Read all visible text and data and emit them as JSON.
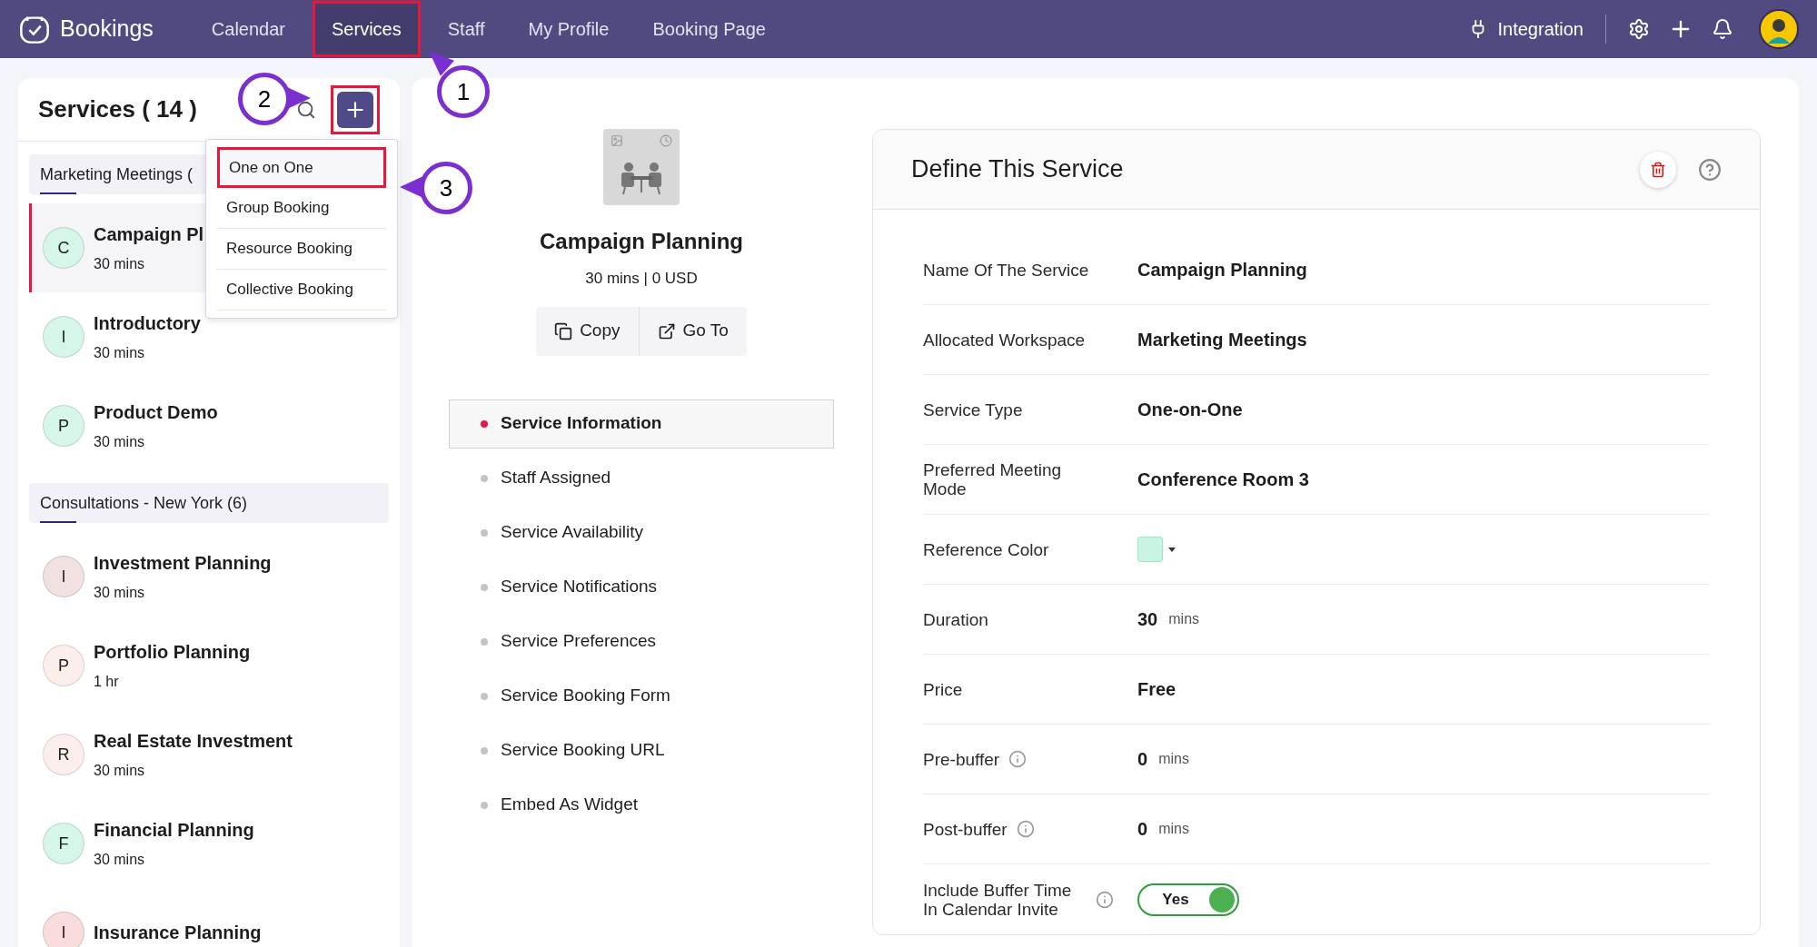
{
  "navbar": {
    "brand": "Bookings",
    "tabs": [
      {
        "label": "Calendar",
        "selected": false,
        "highlighted": false
      },
      {
        "label": "Services",
        "selected": true,
        "highlighted": true
      },
      {
        "label": "Staff",
        "selected": false,
        "highlighted": false
      },
      {
        "label": "My Profile",
        "selected": false,
        "highlighted": false
      },
      {
        "label": "Booking Page",
        "selected": false,
        "highlighted": false
      }
    ],
    "integration": "Integration"
  },
  "services_panel": {
    "title": "Services ( 14 )",
    "add_highlighted": true,
    "groups": [
      {
        "name": "Marketing Meetings (",
        "services": [
          {
            "initial": "C",
            "name": "Campaign Pl",
            "duration": "30 mins",
            "selected": true,
            "color": "#d6f6ea"
          },
          {
            "initial": "I",
            "name": "Introductory",
            "duration": "30 mins",
            "selected": false,
            "color": "#d6f6ea"
          },
          {
            "initial": "P",
            "name": "Product Demo",
            "duration": "30 mins",
            "selected": false,
            "color": "#d6f6ea"
          }
        ]
      },
      {
        "name": "Consultations - New York (6)",
        "services": [
          {
            "initial": "I",
            "name": "Investment Planning",
            "duration": "30 mins",
            "selected": false,
            "color": "#f2e1e1"
          },
          {
            "initial": "P",
            "name": "Portfolio Planning",
            "duration": "1 hr",
            "selected": false,
            "color": "#fcefeb"
          },
          {
            "initial": "R",
            "name": "Real Estate Investment",
            "duration": "30 mins",
            "selected": false,
            "color": "#fcefeb"
          },
          {
            "initial": "F",
            "name": "Financial Planning",
            "duration": "30 mins",
            "selected": false,
            "color": "#d6f6ea"
          },
          {
            "initial": "I",
            "name": "Insurance Planning",
            "selected": false,
            "color": "#f9dcdc"
          }
        ]
      }
    ]
  },
  "add_menu": {
    "items": [
      {
        "label": "One on One",
        "highlighted": true
      },
      {
        "label": "Group Booking",
        "highlighted": false
      },
      {
        "label": "Resource Booking",
        "highlighted": false
      },
      {
        "label": "Collective Booking",
        "highlighted": false
      }
    ]
  },
  "service_summary": {
    "title": "Campaign Planning",
    "subtitle": "30 mins | 0 USD",
    "buttons": [
      {
        "kind": "copy",
        "label": "Copy"
      },
      {
        "kind": "goto",
        "label": "Go To"
      }
    ]
  },
  "sections": [
    {
      "label": "Service Information",
      "selected": true
    },
    {
      "label": "Staff Assigned",
      "selected": false
    },
    {
      "label": "Service Availability",
      "selected": false
    },
    {
      "label": "Service Notifications",
      "selected": false
    },
    {
      "label": "Service Preferences",
      "selected": false
    },
    {
      "label": "Service Booking Form",
      "selected": false
    },
    {
      "label": "Service Booking URL",
      "selected": false
    },
    {
      "label": "Embed As Widget",
      "selected": false
    }
  ],
  "define_service": {
    "title": "Define This Service",
    "fields": [
      {
        "kind": "text",
        "label": "Name Of The Service",
        "value": "Campaign Planning"
      },
      {
        "kind": "text",
        "label": "Allocated Workspace",
        "value": "Marketing Meetings"
      },
      {
        "kind": "text",
        "label": "Service Type",
        "value": "One-on-One"
      },
      {
        "kind": "text",
        "label": "Preferred Meeting Mode",
        "value": "Conference Room 3"
      },
      {
        "kind": "color",
        "label": "Reference Color",
        "color": "#c8f5e3"
      },
      {
        "kind": "number",
        "label": "Duration",
        "value": "30",
        "unit": "mins"
      },
      {
        "kind": "text",
        "label": "Price",
        "value": "Free"
      },
      {
        "kind": "number",
        "label": "Pre-buffer",
        "info": true,
        "value": "0",
        "unit": "mins"
      },
      {
        "kind": "number",
        "label": "Post-buffer",
        "info": true,
        "value": "0",
        "unit": "mins"
      },
      {
        "kind": "toggle",
        "label": "Include Buffer Time In Calendar Invite",
        "info": true,
        "on": true,
        "value": "Yes"
      }
    ]
  },
  "callouts": [
    {
      "label": "1"
    },
    {
      "label": "2"
    },
    {
      "label": "3"
    }
  ]
}
